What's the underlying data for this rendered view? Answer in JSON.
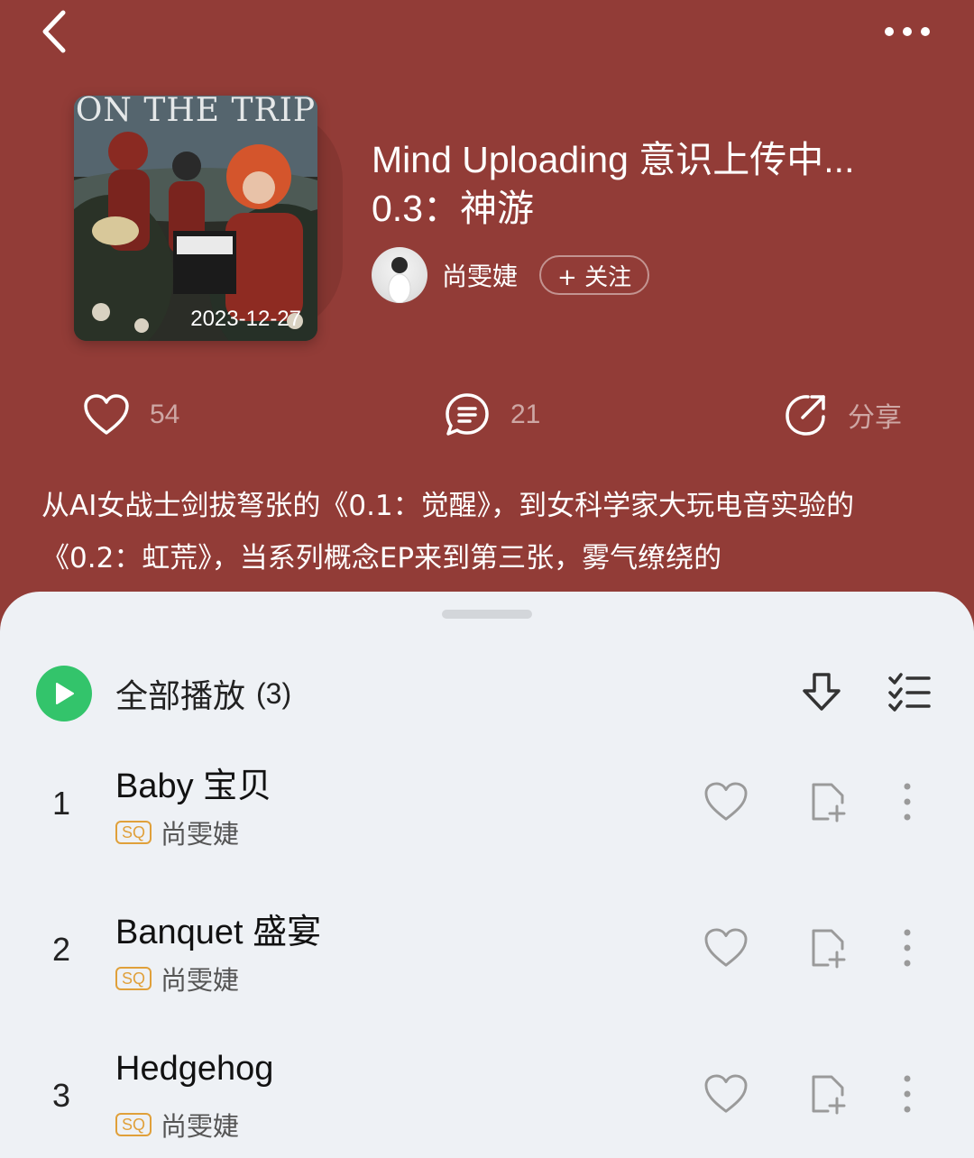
{
  "colors": {
    "header_bg": "#923c37",
    "sheet_bg": "#eef1f5",
    "play_green": "#33c46b",
    "sq_badge": "#e0a03a"
  },
  "header": {
    "back_icon": "chevron-left-icon",
    "more_icon": "more-horizontal-icon"
  },
  "album": {
    "cover_text": "ON THE TRIP",
    "cover_date": "2023-12-27",
    "title": "Mind Uploading 意识上传中... 0.3：神游",
    "artist": "尚雯婕",
    "follow_label": "+ 关注"
  },
  "actions": {
    "like_count": "54",
    "comment_count": "21",
    "share_label": "分享"
  },
  "description": "从AI女战士剑拔弩张的《0.1：觉醒》，到女科学家大玩电音实验的《0.2：虹荒》，当系列概念EP来到第三张，雾气缭绕的",
  "playlist": {
    "play_all_label": "全部播放",
    "play_all_count": "(3)",
    "tracks": [
      {
        "num": "1",
        "title": "Baby 宝贝",
        "badge": "SQ",
        "artist": "尚雯婕"
      },
      {
        "num": "2",
        "title": "Banquet 盛宴",
        "badge": "SQ",
        "artist": "尚雯婕"
      },
      {
        "num": "3",
        "title": "Hedgehog",
        "badge": "SQ",
        "artist": "尚雯婕"
      }
    ]
  }
}
